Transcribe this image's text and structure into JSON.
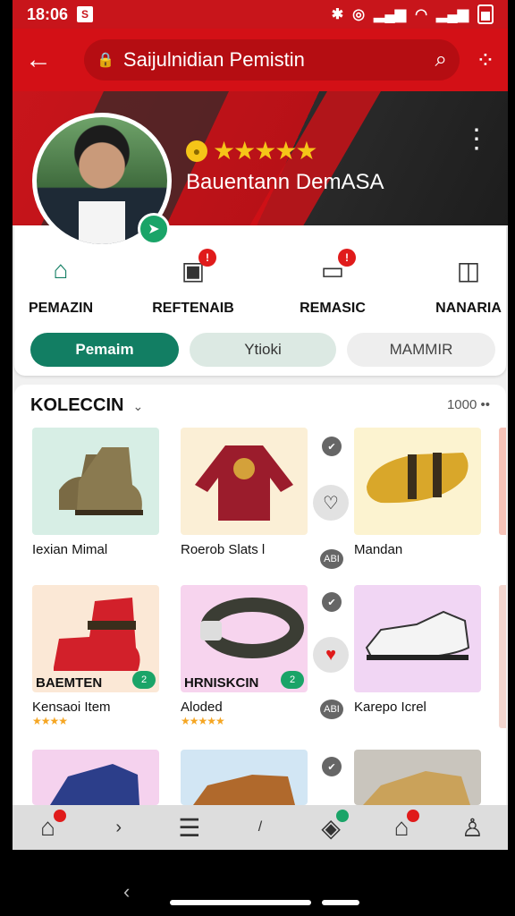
{
  "status_bar": {
    "time": "18:06",
    "notif_glyph": "S"
  },
  "app_bar": {
    "title": "Saijulnidian Pemistin"
  },
  "profile": {
    "rating_stars": "★★★★★",
    "store_name": "Bauentann DemASA"
  },
  "quick_actions": [
    {
      "label": "PEMAZIN",
      "icon": "home-house-icon",
      "badge": ""
    },
    {
      "label": "REFTENAIB",
      "icon": "package-icon",
      "badge": "!"
    },
    {
      "label": "REMASIC",
      "icon": "message-icon",
      "badge": "!"
    },
    {
      "label": "NANARIA",
      "icon": "bag-icon",
      "badge": ""
    }
  ],
  "filter_pills": [
    "Pemaim",
    "Ytioki",
    "MAMMIR"
  ],
  "collection": {
    "title": "KOLECCIN",
    "count": "1000 ••",
    "products": [
      {
        "name": "Iexian Mimal",
        "overlay": "",
        "chip": "",
        "stars": ""
      },
      {
        "name": "Roerob Slats l",
        "overlay": "",
        "chip": "",
        "stars": ""
      },
      {
        "name": "Mandan",
        "overlay": "",
        "chip": "",
        "stars": ""
      },
      {
        "name": "Kensaoi Item",
        "overlay": "BAEMTEN",
        "chip": "2",
        "stars": "★★★★"
      },
      {
        "name": "Aloded",
        "overlay": "HRNISKCIN",
        "chip": "2",
        "stars": "★★★★★"
      },
      {
        "name": "Karepo Icrel",
        "overlay": "",
        "chip": "",
        "stars": ""
      }
    ],
    "side_tags": [
      "ABI",
      "ABI"
    ]
  },
  "colors": {
    "primary_red": "#d31016",
    "accent_green": "#127e63",
    "star": "#f5c518"
  }
}
